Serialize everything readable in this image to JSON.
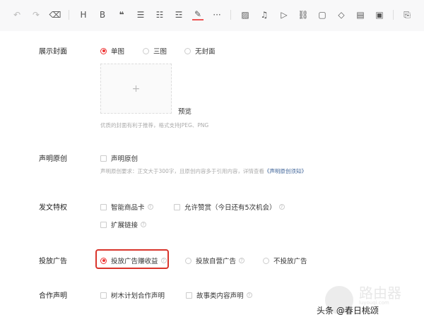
{
  "toolbar": {
    "icons": [
      "undo-icon",
      "redo-icon",
      "eraser-icon",
      "heading-icon",
      "bold-icon",
      "quote-icon",
      "bullet-list-icon",
      "numbered-list-icon",
      "divider-icon",
      "highlight-icon",
      "more-icon",
      "image-icon",
      "music-icon",
      "video-icon",
      "link-icon",
      "bag-icon",
      "diamond-icon",
      "document-icon",
      "ad-card-icon",
      "file-add-icon"
    ],
    "glyphs": {
      "heading": "H",
      "bold": "B",
      "quote": "❝",
      "more": "···"
    }
  },
  "accent": "#e33333",
  "cover": {
    "label": "展示封面",
    "options": [
      {
        "label": "单图",
        "selected": true
      },
      {
        "label": "三图",
        "selected": false
      },
      {
        "label": "无封面",
        "selected": false
      }
    ],
    "plus": "+",
    "preview": "预览",
    "hint": "优质的封面有利于推荐，格式支持JPEG、PNG"
  },
  "original": {
    "label": "声明原创",
    "checkbox": "声明原创",
    "hint": "声明原创要求：正文大于300字，且原创内容多于引用内容，详情查看",
    "link": "《声明原创须知》"
  },
  "privileges": {
    "label": "发文特权",
    "items": [
      "智能商品卡",
      "允许赞赏（今日还有5次机会）",
      "扩展链接"
    ]
  },
  "ads": {
    "label": "投放广告",
    "options": [
      {
        "label": "投放广告赚收益",
        "selected": true
      },
      {
        "label": "投放自营广告",
        "selected": false
      },
      {
        "label": "不投放广告",
        "selected": false
      }
    ]
  },
  "coop": {
    "label": "合作声明",
    "items": [
      "树木计划合作声明",
      "故事类内容声明"
    ]
  },
  "watermark": {
    "brand": "路由器",
    "site": "luyouqi.com",
    "credit": "头条 @春日桃颂"
  }
}
